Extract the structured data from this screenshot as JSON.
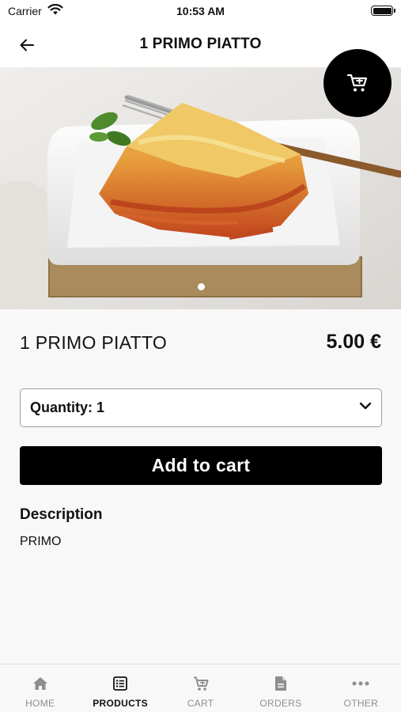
{
  "status_bar": {
    "carrier": "Carrier",
    "time": "10:53 AM"
  },
  "nav": {
    "title": "1 PRIMO PIATTO"
  },
  "icons": {
    "back": "arrow-left-icon",
    "cart": "shopping-cart-icon",
    "chevron": "chevron-down-icon"
  },
  "colors": {
    "accent": "#000000",
    "background": "#f8f8f8",
    "tab_inactive": "#8e8e8e"
  },
  "gallery": {
    "image_count": 1,
    "active_index": 0
  },
  "product": {
    "name": "1 PRIMO PIATTO",
    "price": "5.00 €"
  },
  "quantity": {
    "label": "Quantity: ",
    "value": "1"
  },
  "add_to_cart": {
    "label": "Add to cart"
  },
  "description": {
    "heading": "Description",
    "text": "PRIMO"
  },
  "tabs": [
    {
      "label": "HOME",
      "icon": "home-icon",
      "active": false
    },
    {
      "label": "PRODUCTS",
      "icon": "list-icon",
      "active": true
    },
    {
      "label": "CART",
      "icon": "cart-icon",
      "active": false
    },
    {
      "label": "ORDERS",
      "icon": "document-icon",
      "active": false
    },
    {
      "label": "OTHER",
      "icon": "more-icon",
      "active": false
    }
  ]
}
